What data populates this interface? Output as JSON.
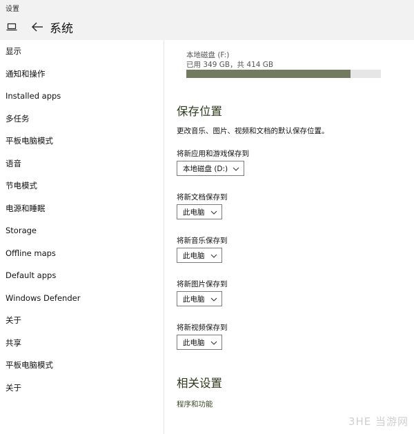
{
  "window": {
    "title": "设置"
  },
  "header": {
    "title": "系统",
    "icons": {
      "device": "laptop-icon",
      "back": "back-arrow-icon"
    }
  },
  "sidebar": {
    "items": [
      {
        "label": "显示"
      },
      {
        "label": "通知和操作"
      },
      {
        "label": "Installed apps"
      },
      {
        "label": "多任务"
      },
      {
        "label": "平板电脑模式"
      },
      {
        "label": "语音"
      },
      {
        "label": "节电模式"
      },
      {
        "label": "电源和睡眠"
      },
      {
        "label": "Storage"
      },
      {
        "label": "Offline maps"
      },
      {
        "label": "Default apps"
      },
      {
        "label": "Windows Defender"
      },
      {
        "label": "关于"
      },
      {
        "label": "共享"
      },
      {
        "label": "平板电脑模式"
      },
      {
        "label": "关于"
      }
    ]
  },
  "main": {
    "drive": {
      "name": "本地磁盘 (F:)",
      "usage_text": "已用 349 GB，共 414 GB",
      "used_fraction": 0.843
    },
    "save_locations": {
      "title": "保存位置",
      "description": "更改音乐、图片、视频和文档的默认保存位置。",
      "fields": [
        {
          "label": "将新应用和游戏保存到",
          "value": "本地磁盘 (D:)"
        },
        {
          "label": "将新文档保存到",
          "value": "此电脑"
        },
        {
          "label": "将新音乐保存到",
          "value": "此电脑"
        },
        {
          "label": "将新图片保存到",
          "value": "此电脑"
        },
        {
          "label": "将新视频保存到",
          "value": "此电脑"
        }
      ]
    },
    "related": {
      "title": "相关设置",
      "link": "程序和功能"
    }
  },
  "watermark": "3HE 当游网",
  "colors": {
    "accent": "#727b5f",
    "bar_track": "#e6e6e6",
    "header_bg": "#f2f2f2"
  }
}
